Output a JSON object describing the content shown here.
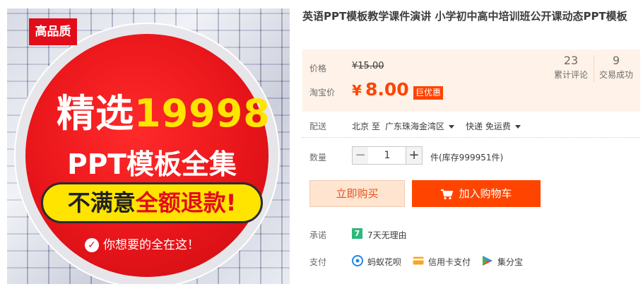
{
  "hero": {
    "badge": "高品质",
    "line1_a": "精选",
    "line1_b": "19998",
    "line2": "PPT模板全集",
    "pill_a": "不满意",
    "pill_b": "全额退款!",
    "footer": "你想要的全在这！"
  },
  "product": {
    "title": "英语PPT模板教学课件演讲 小学初中高中培训班公开课动态PPT模板"
  },
  "price": {
    "label": "价格",
    "original": "¥15.00",
    "taobao_label": "淘宝价",
    "currency": "¥",
    "current": "8.00",
    "coupon": "巨优惠"
  },
  "stats": [
    {
      "value": "23",
      "label": "累计评论"
    },
    {
      "value": "9",
      "label": "交易成功"
    }
  ],
  "shipping": {
    "label": "配送",
    "from": "北京 至",
    "to": "广东珠海金湾区",
    "method": "快递 免运费"
  },
  "quantity": {
    "label": "数量",
    "minus": "−",
    "value": "1",
    "plus": "+",
    "unit_stock": "件(库存999951件)"
  },
  "actions": {
    "buy_now": "立即购买",
    "add_to_cart": "加入购物车"
  },
  "promise": {
    "label": "承诺",
    "icon_text": "7",
    "text": "7天无理由"
  },
  "payment": {
    "label": "支付",
    "methods": [
      {
        "icon": "huabei-icon",
        "label": "蚂蚁花呗",
        "color": "#1e88e5"
      },
      {
        "icon": "credit-card-icon",
        "label": "信用卡支付",
        "color": "#f5a623"
      },
      {
        "icon": "jifenbao-icon",
        "label": "集分宝",
        "color": "#4caf50"
      }
    ]
  },
  "colors": {
    "accent": "#ff4400",
    "price_bg": "#fff2e8",
    "badge_red": "#e20d1a",
    "highlight_yellow": "#ffe400"
  }
}
